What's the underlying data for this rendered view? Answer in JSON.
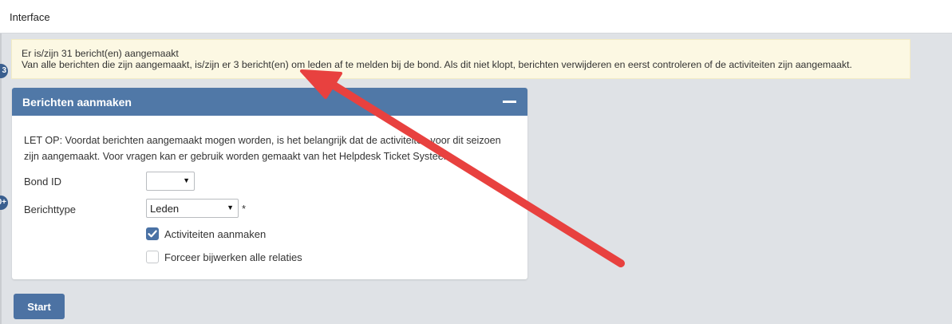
{
  "header": {
    "title": "Interface"
  },
  "side_badges": [
    "3",
    "0+"
  ],
  "alert": {
    "line1": "Er is/zijn 31 bericht(en) aangemaakt",
    "line2": "Van alle berichten die zijn aangemaakt, is/zijn er 3 bericht(en) om leden af te melden bij de bond. Als dit niet klopt, berichten verwijderen en eerst controleren of de activiteiten zijn aangemaakt."
  },
  "panel": {
    "title": "Berichten aanmaken",
    "intro": "LET OP: Voordat berichten aangemaakt mogen worden, is het belangrijk dat de activiteiten voor dit seizoen zijn aangemaakt. Voor vragen kan er gebruik worden gemaakt van het Helpdesk Ticket Systeem.",
    "fields": {
      "bond_id": {
        "label": "Bond ID",
        "value": ""
      },
      "berichttype": {
        "label": "Berichttype",
        "value": "Leden",
        "required_mark": "*"
      }
    },
    "checkboxes": [
      {
        "label": "Activiteiten aanmaken",
        "checked": true
      },
      {
        "label": "Forceer bijwerken alle relaties",
        "checked": false
      }
    ]
  },
  "start_button": {
    "label": "Start"
  },
  "colors": {
    "panel_header": "#5078a7",
    "alert_bg": "#fcf8e3",
    "annotation_arrow": "#e8413f",
    "button": "#4c72a3"
  },
  "icons": {
    "dropdown": "caret-down-icon",
    "checkbox_checked": "checkmark-icon",
    "collapse": "minus-icon"
  }
}
